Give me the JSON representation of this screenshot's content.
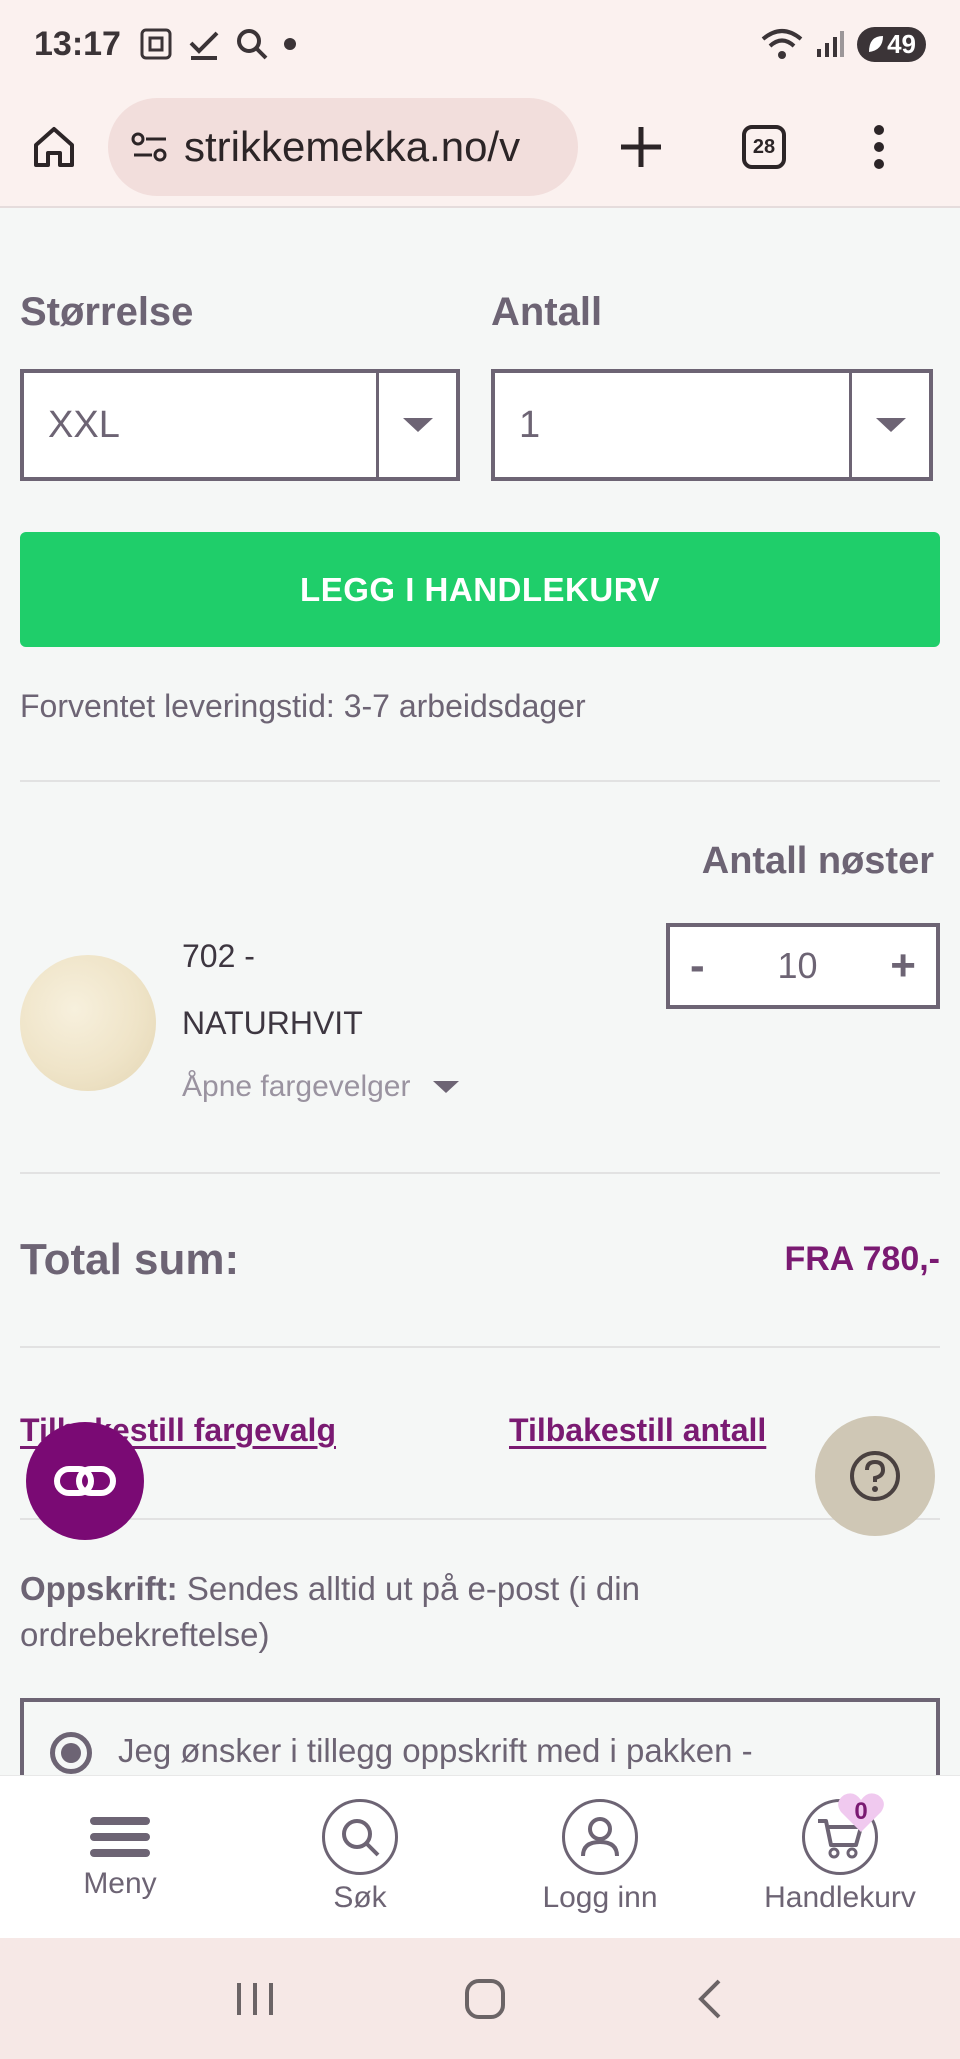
{
  "status_bar": {
    "time": "13:17",
    "battery": "49"
  },
  "browser": {
    "url": "strikkemekka.no/v",
    "tab_count": "28"
  },
  "product": {
    "size_label": "Størrelse",
    "size_value": "XXL",
    "quantity_label": "Antall",
    "quantity_value": "1",
    "add_to_cart": "LEGG I HANDLEKURV",
    "delivery_time": "Forventet leveringstid: 3-7 arbeidsdager"
  },
  "color_selection": {
    "skeins_label": "Antall nøster",
    "color_name_line1": "702 -",
    "color_name_line2": "NATURHVIT",
    "open_picker": "Åpne fargevelger",
    "skeins_minus": "-",
    "skeins_value": "10",
    "skeins_plus": "+"
  },
  "total": {
    "label": "Total sum:",
    "value": "FRA 780,-"
  },
  "links": {
    "reset_colors": "Tilbakestill fargevalg",
    "reset_quantity": "Tilbakestill antall"
  },
  "pattern": {
    "label": "Oppskrift:",
    "text": "Sendes alltid ut på e-post (i din ordrebekreftelse)",
    "option_text": "Jeg ønsker i tillegg oppskrift med i pakken -"
  },
  "bottom_nav": {
    "menu": "Meny",
    "search": "Søk",
    "login": "Logg inn",
    "cart": "Handlekurv",
    "cart_count": "0"
  },
  "colors": {
    "accent": "#7a1a72",
    "button_green": "#1fce6a",
    "text": "#6d6474"
  }
}
